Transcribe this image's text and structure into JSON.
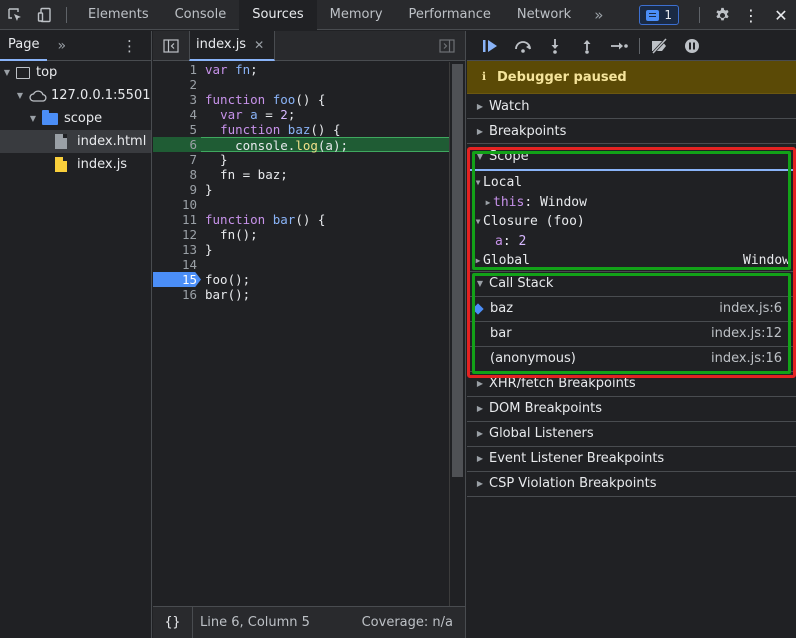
{
  "topbar": {
    "tabs": [
      "Elements",
      "Console",
      "Sources",
      "Memory",
      "Performance",
      "Network"
    ],
    "active_tab": "Sources",
    "more_label": "»",
    "issues_count": "1",
    "colors": {
      "issue_badge": "#4b8ef7"
    }
  },
  "navigator": {
    "tab_label": "Page",
    "more_label": "»",
    "tree": [
      {
        "label": "top",
        "depth": 0,
        "icon": "frame-icon",
        "expanded": true
      },
      {
        "label": "127.0.0.1:5501",
        "depth": 1,
        "icon": "cloud-icon",
        "expanded": true
      },
      {
        "label": "scope",
        "depth": 2,
        "icon": "folder-icon",
        "expanded": true
      },
      {
        "label": "index.html",
        "depth": 3,
        "icon": "file-html-icon",
        "selected": true
      },
      {
        "label": "index.js",
        "depth": 3,
        "icon": "file-js-icon"
      }
    ]
  },
  "editor": {
    "file_tab": "index.js",
    "paused_line": 6,
    "breakpoint_line": 15,
    "lines": [
      [
        [
          "kw",
          "var "
        ],
        [
          "fn",
          "fn"
        ],
        [
          "plain",
          ";"
        ]
      ],
      [],
      [
        [
          "kw",
          "function "
        ],
        [
          "fn",
          "foo"
        ],
        [
          "plain",
          "() {"
        ]
      ],
      [
        [
          "plain",
          "  "
        ],
        [
          "kw",
          "var "
        ],
        [
          "fn",
          "a"
        ],
        [
          "plain",
          " = "
        ],
        [
          "num",
          "2"
        ],
        [
          "plain",
          ";"
        ]
      ],
      [
        [
          "plain",
          "  "
        ],
        [
          "kw",
          "function "
        ],
        [
          "fn",
          "baz"
        ],
        [
          "plain",
          "() {"
        ]
      ],
      [
        [
          "plain",
          "    console."
        ],
        [
          "call",
          "log"
        ],
        [
          "plain",
          "(a);"
        ]
      ],
      [
        [
          "plain",
          "  }"
        ]
      ],
      [
        [
          "plain",
          "  fn = baz;"
        ]
      ],
      [
        [
          "plain",
          "}"
        ]
      ],
      [],
      [
        [
          "kw",
          "function "
        ],
        [
          "fn",
          "bar"
        ],
        [
          "plain",
          "() {"
        ]
      ],
      [
        [
          "plain",
          "  fn();"
        ]
      ],
      [
        [
          "plain",
          "}"
        ]
      ],
      [],
      [
        [
          "plain",
          "foo();"
        ]
      ],
      [
        [
          "plain",
          "bar();"
        ]
      ]
    ],
    "footer": {
      "pretty_print": "{}",
      "position": "Line 6, Column 5",
      "coverage": "Coverage: n/a"
    }
  },
  "debugger": {
    "paused_label": "Debugger paused",
    "sections_top": [
      "Watch",
      "Breakpoints"
    ],
    "scope": {
      "title": "Scope",
      "local_label": "Local",
      "this_key": "this",
      "this_value": "Window",
      "closure_label": "Closure (foo)",
      "a_key": "a",
      "a_value": "2",
      "global_label": "Global",
      "global_value": "Window"
    },
    "call_stack": {
      "title": "Call Stack",
      "frames": [
        {
          "name": "baz",
          "location": "index.js:6",
          "current": true
        },
        {
          "name": "bar",
          "location": "index.js:12"
        },
        {
          "name": "(anonymous)",
          "location": "index.js:16"
        }
      ]
    },
    "sections_bottom": [
      "XHR/fetch Breakpoints",
      "DOM Breakpoints",
      "Global Listeners",
      "Event Listener Breakpoints",
      "CSP Violation Breakpoints"
    ]
  }
}
